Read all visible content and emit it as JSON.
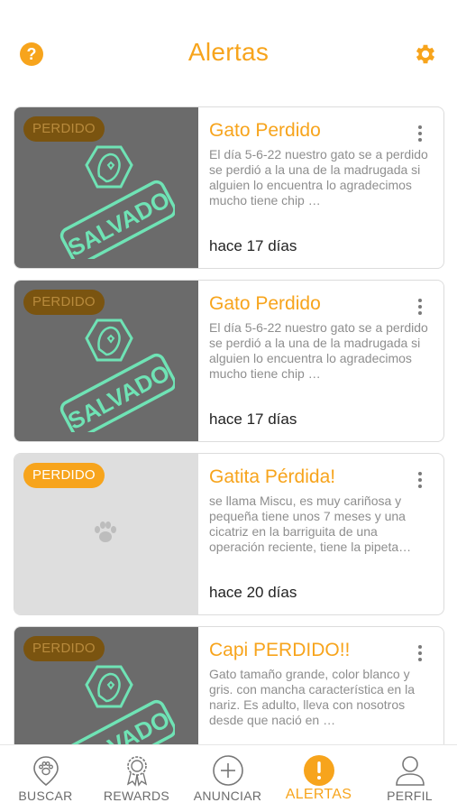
{
  "header": {
    "title": "Alertas",
    "help_icon": "question-circle-icon",
    "settings_icon": "gear-icon"
  },
  "colors": {
    "accent": "#F7A41C",
    "stamp": "#6FE3B5",
    "thumb_dark": "#6B6B6B",
    "thumb_light": "#DEDEDE"
  },
  "alerts": [
    {
      "badge": "PERDIDO",
      "title": "Gato Perdido",
      "description": "El día 5-6-22 nuestro gato se a perdido se perdió a la una de la madrugada si alguien lo encuentra lo agradecimos mucho tiene chip …",
      "age": "hace 17 días",
      "stamp": "SALVADO"
    },
    {
      "badge": "PERDIDO",
      "title": "Gato Perdido",
      "description": "El día 5-6-22 nuestro gato se a perdido se perdió a la una de la madrugada si alguien lo encuentra lo agradecimos mucho tiene chip …",
      "age": "hace 17 días",
      "stamp": "SALVADO"
    },
    {
      "badge": "PERDIDO",
      "title": "Gatita Pérdida!",
      "description": "se llama Miscu, es muy cariñosa y pequeña tiene unos 7 meses y una cicatriz en la barriguita de una operación reciente, tiene la pipeta…",
      "age": "hace 20 días",
      "stamp": ""
    },
    {
      "badge": "PERDIDO",
      "title": "Capi PERDIDO!!",
      "description": "Gato tamaño grande, color blanco y gris. con mancha característica en la nariz. Es adulto, lleva con nosotros desde que nació en …",
      "age": "",
      "stamp": "SALVADO"
    }
  ],
  "tabs": [
    {
      "label": "BUSCAR",
      "icon": "paw-pin-icon"
    },
    {
      "label": "REWARDS",
      "icon": "award-icon"
    },
    {
      "label": "ANUNCIAR",
      "icon": "plus-circle-icon"
    },
    {
      "label": "ALERTAS",
      "icon": "alert-circle-icon",
      "active": true
    },
    {
      "label": "PERFIL",
      "icon": "user-icon"
    }
  ]
}
